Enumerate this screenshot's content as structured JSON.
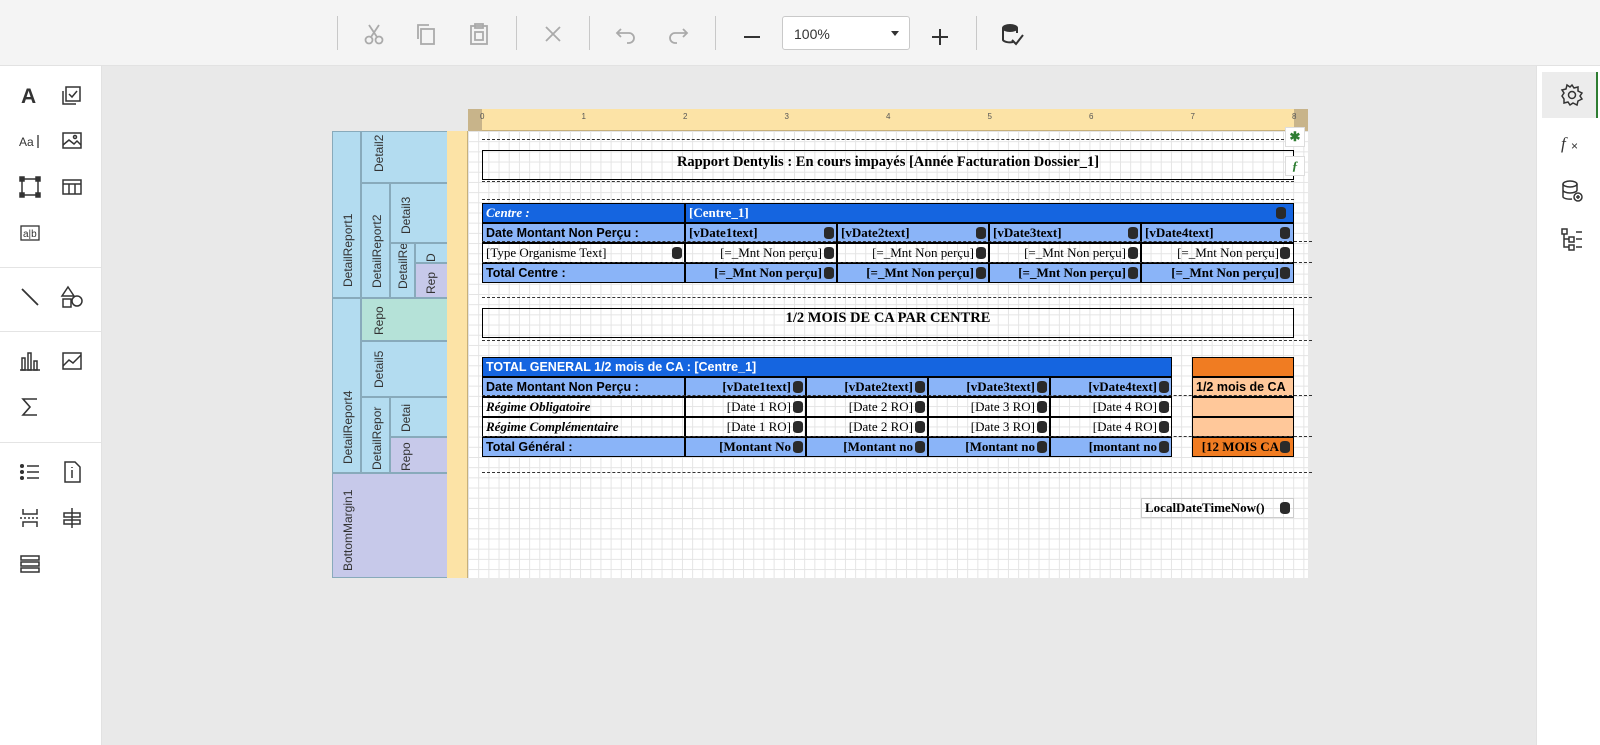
{
  "toolbar": {
    "zoom_value": "100%",
    "buttons": [
      "cut-icon",
      "copy-icon",
      "paste-icon",
      "delete-icon",
      "undo-icon",
      "redo-icon",
      "zoom-out-icon",
      "zoom-in-icon",
      "validate-icon"
    ]
  },
  "bands": {
    "detail2": "Detail2",
    "detail3": "Detail3",
    "detailreport1": "DetailReport1",
    "detailreport2": "DetailReport2",
    "detailre": "DetailRe",
    "d": "D",
    "rep": "Rep",
    "repo": "Repo",
    "detail5": "Detail5",
    "detailreport4": "DetailReport4",
    "detailrepor": "DetailRepor",
    "detai": "Detai",
    "repo2": "Repo",
    "bottommargin1": "BottomMargin1"
  },
  "ruler": {
    "ticks": [
      "0",
      "1",
      "2",
      "3",
      "4",
      "5",
      "6",
      "7",
      "8"
    ]
  },
  "report": {
    "title": "Rapport Dentylis : En cours impayés [Année Facturation Dossier_1]",
    "centre_label": "Centre :",
    "centre_value": "[Centre_1]",
    "date_label": "Date Montant Non Perçu :",
    "vdate1": "[vDate1text]",
    "vdate2": "[vDate2text]",
    "vdate3": "[vDate3text]",
    "vdate4": "[vDate4text]",
    "type_org": "[Type Organisme Text]",
    "mnt": "[=_Mnt Non perçu]",
    "total_centre": "Total Centre :",
    "half_title": "1/2 MOIS DE CA PAR CENTRE",
    "total_general_header": "TOTAL GENERAL  1/2 mois de CA :  [Centre_1]",
    "half_ca_label": "1/2 mois de CA",
    "regime_obl": "Régime Obligatoire",
    "regime_comp": "Régime Complémentaire",
    "date1r": "[Date 1 RO]",
    "date2r": "[Date 2 RO]",
    "date3r": "[Date 3 RO]",
    "date4r": "[Date 4 RO]",
    "total_general": "Total Général :",
    "montant1": "[Montant No",
    "montant2": "[Montant no",
    "montant3": "[Montant no",
    "montant4": "[montant no",
    "twelve_mois": "[12 MOIS CA",
    "local_date": "LocalDateTimeNow()"
  },
  "colors": {
    "blue_dark": "#1565e0",
    "blue_light": "#8ab4f8",
    "orange_dark": "#f07c22",
    "orange_light": "#ffc89a"
  }
}
